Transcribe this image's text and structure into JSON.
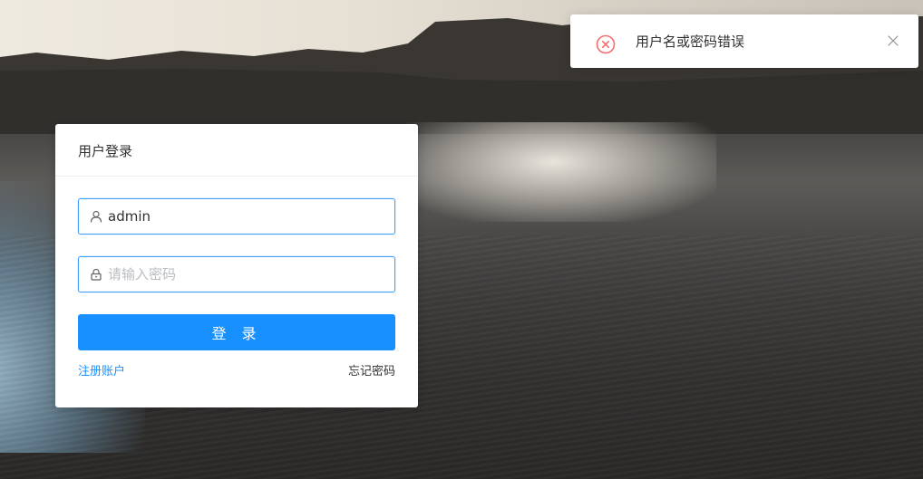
{
  "login_card": {
    "title": "用户登录",
    "username": {
      "icon": "user-icon",
      "value": "admin"
    },
    "password": {
      "icon": "lock-icon",
      "value": "",
      "placeholder": "请输入密码"
    },
    "submit_label": "登 录",
    "register_link": "注册账户",
    "forgot_link": "忘记密码"
  },
  "notification": {
    "icon": "error-circle-icon",
    "message": "用户名或密码错误",
    "close_icon": "close-icon"
  },
  "colors": {
    "primary": "#1890ff",
    "focus_border": "#409eff",
    "error": "#f56c6c"
  }
}
